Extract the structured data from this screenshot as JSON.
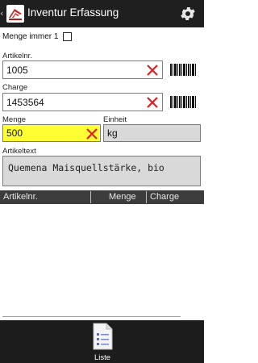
{
  "app": {
    "title": "Inventur Erfassung",
    "logo_text": "ansys"
  },
  "form": {
    "menge_immer_1_label": "Menge immer 1",
    "menge_immer_1_checked": false,
    "artikelnr_label": "Artikelnr.",
    "artikelnr_value": "1005",
    "charge_label": "Charge",
    "charge_value": "1453564",
    "menge_label": "Menge",
    "menge_value": "500",
    "einheit_label": "Einheit",
    "einheit_value": "kg",
    "artikeltext_label": "Artikeltext",
    "artikeltext_value": "Quemena Maisquellstärke, bio"
  },
  "table": {
    "columns": [
      "Artikelnr.",
      "Menge",
      "Charge"
    ],
    "rows": []
  },
  "bottom_nav": {
    "list_label": "Liste"
  },
  "colors": {
    "actionbar": "#1f1f1f",
    "highlight_field": "#ffff33",
    "readonly_field": "#d9d9d9",
    "clear_x": "#e02020",
    "table_header": "#3c3c3c"
  }
}
